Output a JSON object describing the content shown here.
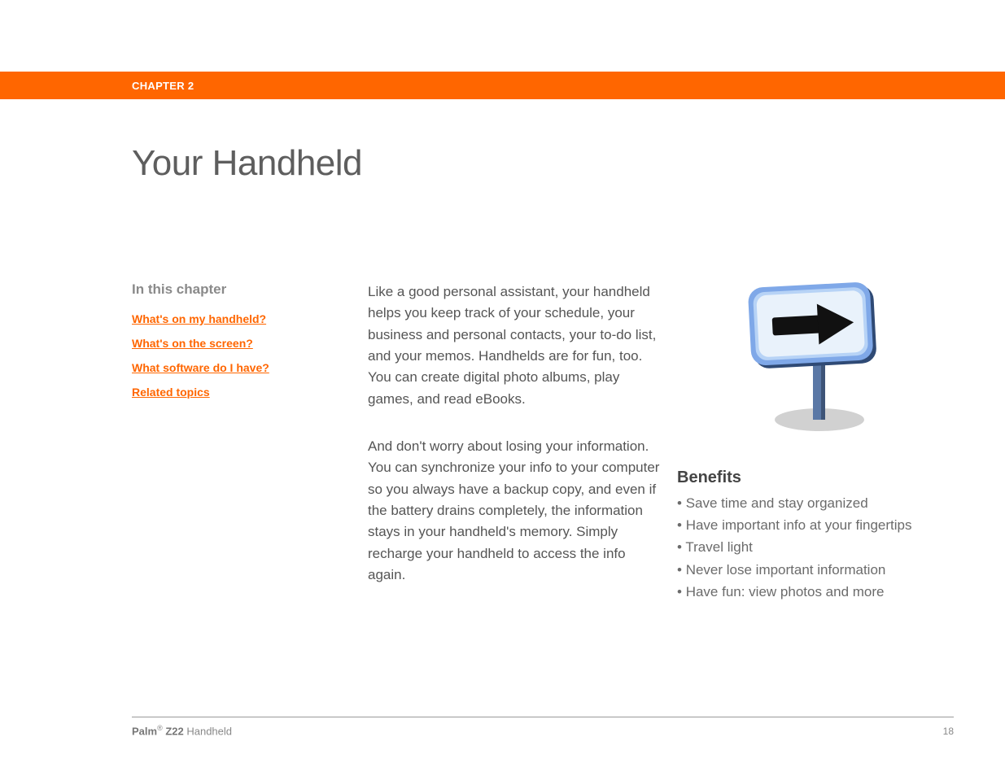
{
  "chapter_label": "CHAPTER 2",
  "page_title": "Your Handheld",
  "sidebar": {
    "heading": "In this chapter",
    "links": [
      "What's on my handheld?",
      "What's on the screen?",
      "What software do I have?",
      "Related topics"
    ]
  },
  "body": {
    "para1": "Like a good personal assistant, your handheld helps you keep track of your schedule, your business and personal contacts, your to-do list, and your memos. Handhelds are for fun, too. You can create digital photo albums, play games, and read eBooks.",
    "para2": "And don't worry about losing your information. You can synchronize your info to your computer so you always have a backup copy, and even if the battery drains completely, the information stays in your handheld's memory. Simply recharge your handheld to access the info again."
  },
  "benefits": {
    "heading": "Benefits",
    "items": [
      "Save time and stay organized",
      "Have important info at your fingertips",
      "Travel light",
      "Never lose important information",
      "Have fun: view photos and more"
    ]
  },
  "footer": {
    "brand_prefix": "Palm",
    "brand_reg": "®",
    "brand_model": " Z22",
    "brand_suffix": " Handheld",
    "page_number": "18"
  },
  "illustration_name": "road-sign-arrow-icon"
}
